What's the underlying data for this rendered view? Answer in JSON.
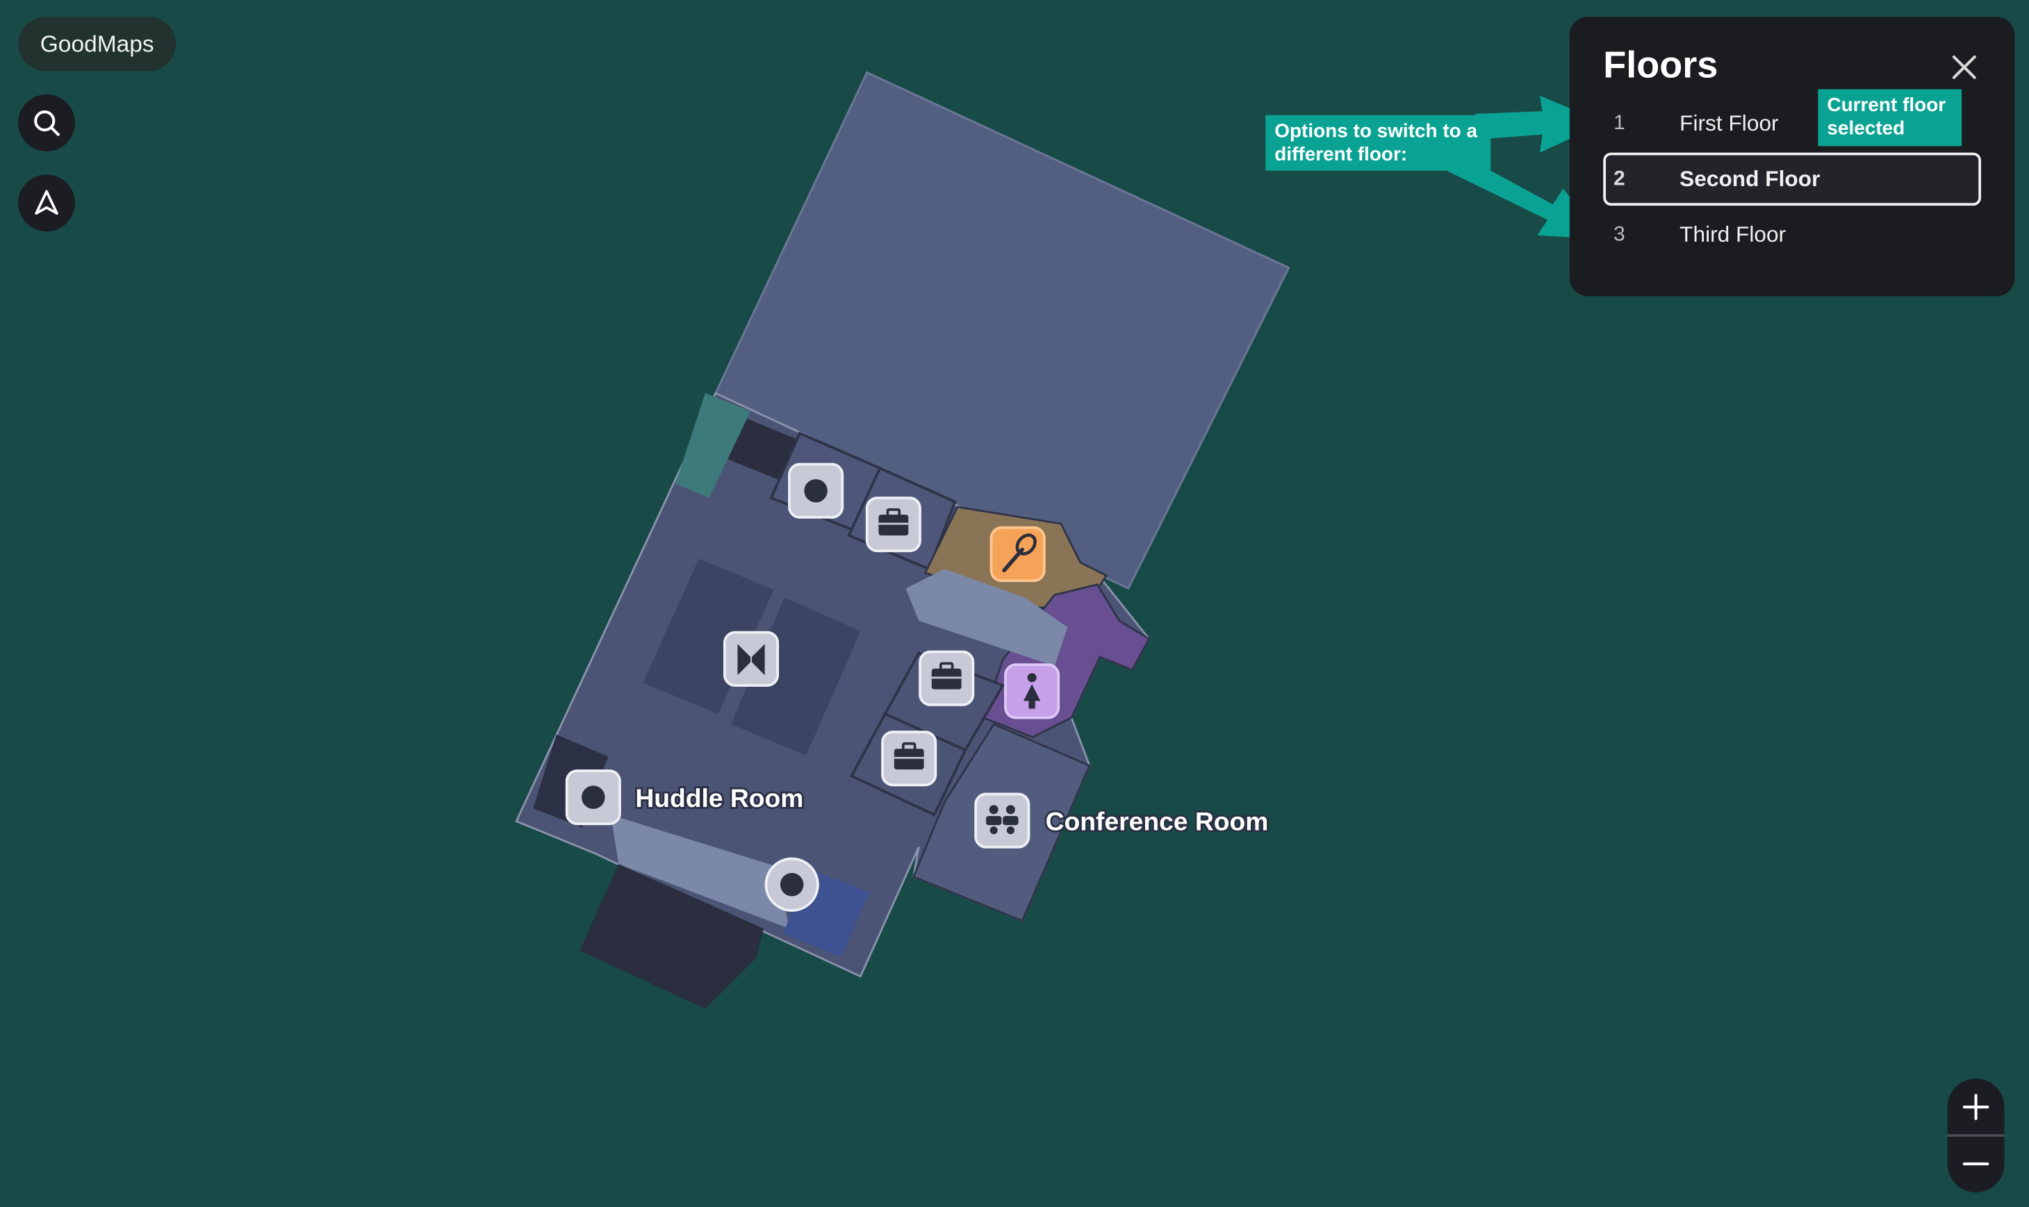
{
  "app": {
    "brand": "GoodMaps"
  },
  "toolbar": {
    "search_icon": "search-icon",
    "locate_icon": "navigation-arrow-icon"
  },
  "floors_panel": {
    "title": "Floors",
    "close_icon": "close-icon",
    "floors": [
      {
        "number": "1",
        "label": "First Floor",
        "selected": false
      },
      {
        "number": "2",
        "label": "Second Floor",
        "selected": true
      },
      {
        "number": "3",
        "label": "Third Floor",
        "selected": false
      }
    ]
  },
  "annotations": {
    "switch_floor": "Options to switch to a different floor:",
    "current_floor": "Current floor selected"
  },
  "map": {
    "rooms": [
      {
        "label": "Huddle Room",
        "icon": "circle-marker-icon"
      },
      {
        "label": "Conference Room",
        "icon": "people-icon"
      }
    ],
    "pois": [
      "circle-marker-icon",
      "briefcase-icon",
      "food-spatula-icon",
      "elevator-icon",
      "briefcase-icon",
      "restroom-women-icon",
      "briefcase-icon",
      "circle-marker-icon"
    ]
  },
  "zoom": {
    "in_icon": "plus-icon",
    "out_icon": "minus-icon"
  },
  "colors": {
    "background": "#184a47",
    "building": "#525f80",
    "floor_base": "#4b5474",
    "accent_callout": "#0aa393",
    "panel": "#1b1c20",
    "food_poi": "#f6a35a",
    "restroom": "#684f91"
  }
}
